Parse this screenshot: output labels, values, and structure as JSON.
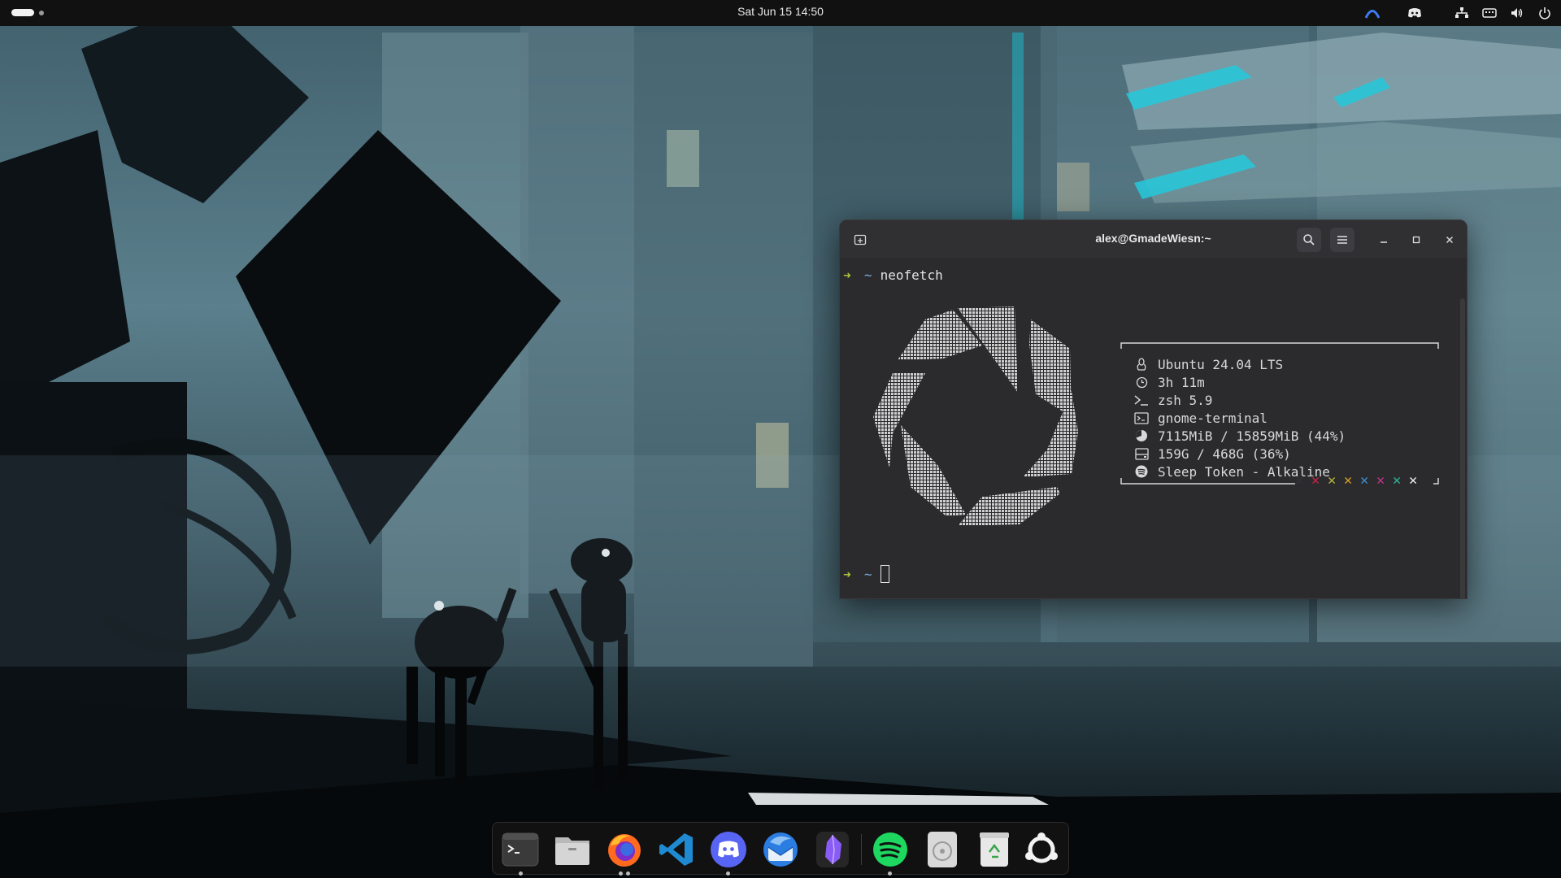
{
  "topbar": {
    "clock": "Sat Jun 15  14:50",
    "tray_icons": [
      "vpn-icon",
      "discord-tray-icon",
      "network-icon",
      "keyboard-layout-icon",
      "volume-icon",
      "power-icon"
    ]
  },
  "terminal": {
    "title": "alex@GmadeWiesn:~",
    "command": "neofetch",
    "prompt_symbol": "➜",
    "prompt_dir": "~",
    "info": [
      {
        "icon": "linux-penguin-icon",
        "text": "Ubuntu 24.04 LTS"
      },
      {
        "icon": "clock-icon",
        "text": "3h 11m"
      },
      {
        "icon": "shell-prompt-icon",
        "text": "zsh 5.9"
      },
      {
        "icon": "terminal-icon",
        "text": "gnome-terminal"
      },
      {
        "icon": "memory-pie-icon",
        "text": "7115MiB / 15859MiB (44%)"
      },
      {
        "icon": "disk-icon",
        "text": "159G / 468G (36%)"
      },
      {
        "icon": "spotify-small-icon",
        "text": "Sleep Token - Alkaline"
      }
    ],
    "color_marks": [
      {
        "glyph": "✕",
        "color": "#2e3436"
      },
      {
        "glyph": "✕",
        "color": "#cc2244"
      },
      {
        "glyph": "✕",
        "color": "#b6b63a"
      },
      {
        "glyph": "✕",
        "color": "#d4a021"
      },
      {
        "glyph": "✕",
        "color": "#3b8fd4"
      },
      {
        "glyph": "✕",
        "color": "#c2338a"
      },
      {
        "glyph": "✕",
        "color": "#2fb59a"
      },
      {
        "glyph": "✕",
        "color": "#f0f0f0"
      }
    ],
    "accent_prompt": "#a9c93a",
    "accent_dir": "#7aaedc"
  },
  "dock": {
    "items": [
      {
        "name": "terminal",
        "running": true
      },
      {
        "name": "files",
        "running": false
      },
      {
        "name": "firefox",
        "running": true
      },
      {
        "name": "vscode",
        "running": false
      },
      {
        "name": "discord",
        "running": true
      },
      {
        "name": "thunderbird",
        "running": false
      },
      {
        "name": "obsidian",
        "running": false
      },
      {
        "name": "spotify",
        "running": true
      },
      {
        "name": "disk-utility",
        "running": false
      },
      {
        "name": "trash",
        "running": false
      },
      {
        "name": "ubuntu-apps",
        "running": false
      }
    ]
  }
}
